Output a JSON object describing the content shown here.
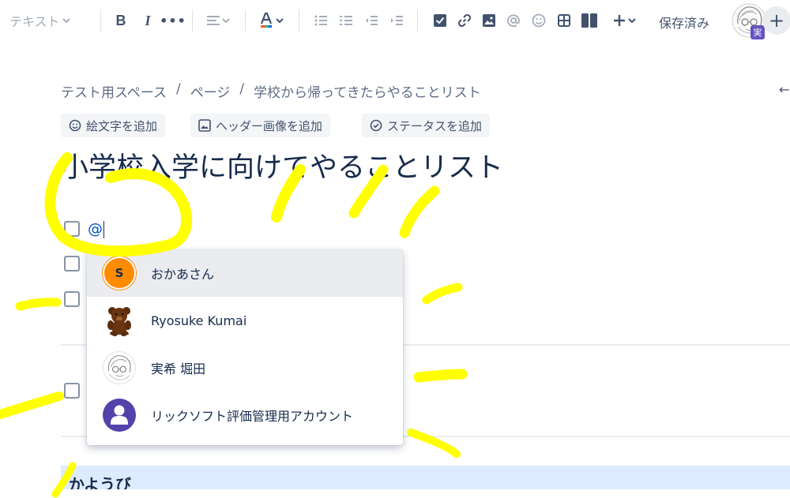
{
  "toolbar": {
    "text_style": "テキスト",
    "bold": "B",
    "italic": "I",
    "more": "•••",
    "saved": "保存済み",
    "avatar_badge": "実",
    "add": "+"
  },
  "breadcrumb": {
    "items": [
      "テスト用スペース",
      "ページ",
      "学校から帰ってきたらやることリスト"
    ],
    "separator": "/"
  },
  "page_actions": {
    "emoji": "絵文字を追加",
    "header_image": "ヘッダー画像を追加",
    "status": "ステータスを追加"
  },
  "page": {
    "title": "小学校入学に向けてやることリスト",
    "mention_text": "@",
    "heading_partial": "かようび"
  },
  "mention_dropdown": {
    "items": [
      {
        "name": "おかあさん",
        "avatar_letter": "S",
        "avatar_color": "#ff8b00"
      },
      {
        "name": "Ryosuke Kumai",
        "avatar_icon": "teddy-bear-icon"
      },
      {
        "name": "実希 堀田",
        "avatar_icon": "sketch-portrait-icon"
      },
      {
        "name": "リックソフト評価管理用アカウント",
        "avatar_icon": "default-user-icon",
        "avatar_color": "#5243aa"
      }
    ]
  },
  "colors": {
    "highlight_scribble": "#ffff00",
    "link": "#0052cc",
    "text": "#172b4d"
  }
}
